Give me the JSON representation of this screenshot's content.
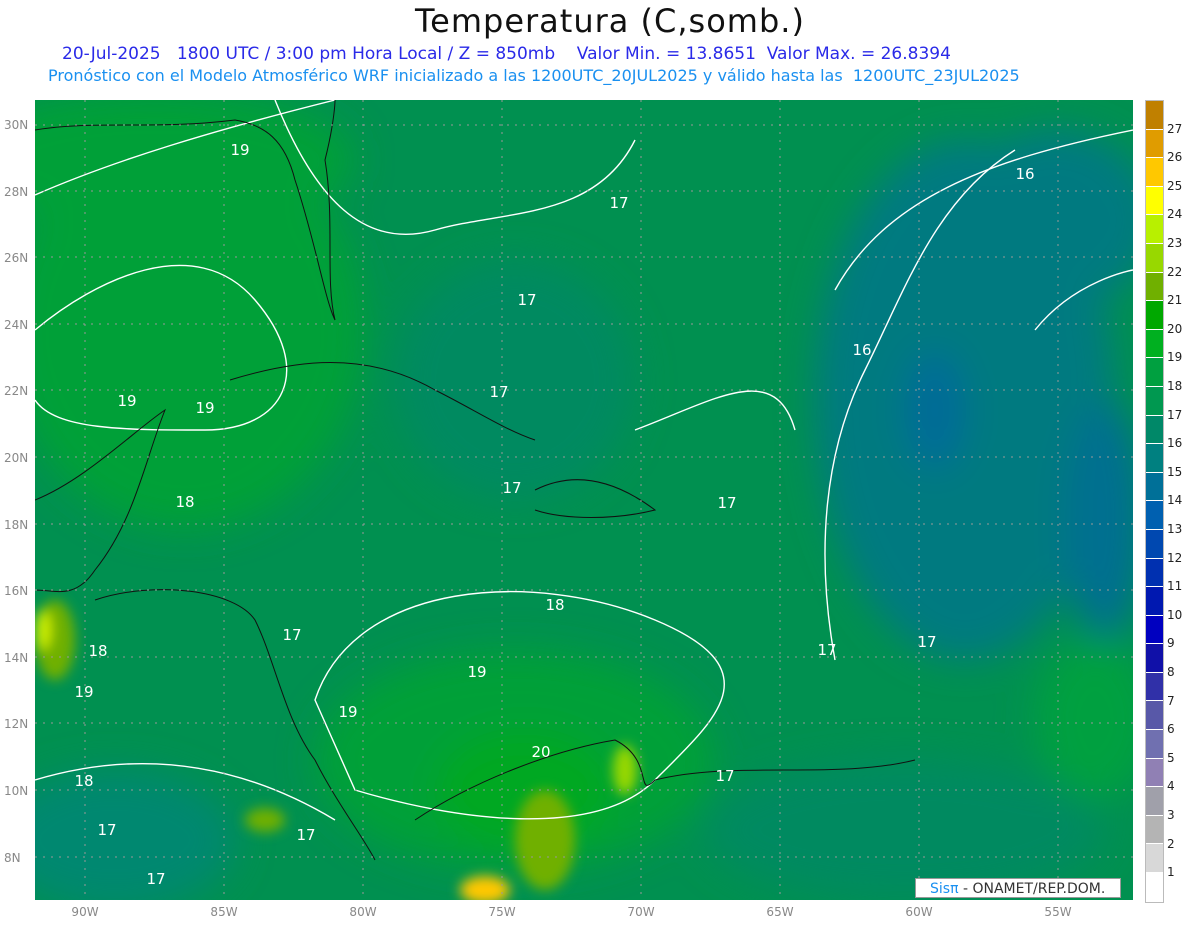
{
  "header": {
    "title": "Temperatura (C,somb.)",
    "line1": "20-Jul-2025   1800 UTC / 3:00 pm Hora Local / Z = 850mb    Valor Min. = 13.8651  Valor Max. = 26.8394",
    "line2": "Pronóstico con el Modelo Atmosférico WRF inicializado a las 1200UTC_20JUL2025 y válido hasta las  1200UTC_23JUL2025"
  },
  "axes": {
    "lon_labels": [
      "90W",
      "85W",
      "80W",
      "75W",
      "70W",
      "65W",
      "60W",
      " 55W"
    ],
    "lat_labels": [
      "30N",
      "28N",
      "26N",
      "24N",
      "22N",
      "20N",
      "18N",
      "16N",
      "14N",
      "12N",
      "10N",
      "8N"
    ]
  },
  "colorbar": {
    "labels": [
      "27",
      "26",
      "25",
      "24",
      "23",
      "22",
      "21",
      "20",
      "19",
      "18",
      "17",
      "16",
      "15",
      "14",
      "13",
      "12",
      "11",
      "10",
      "9",
      "8",
      "7",
      "6",
      "5",
      "4",
      "3",
      "2",
      "1"
    ],
    "colors": [
      "#c08000",
      "#e09c00",
      "#ffc800",
      "#ffff00",
      "#b8f000",
      "#98d800",
      "#70b000",
      "#00a800",
      "#00b020",
      "#00a040",
      "#009850",
      "#008868",
      "#008080",
      "#007098",
      "#0060b0",
      "#0048b0",
      "#0030b0",
      "#0018b0",
      "#0000c0",
      "#1010a8",
      "#3030a8",
      "#5858a8",
      "#7070b0",
      "#9080b4",
      "#a0a0aa",
      "#b4b4b4",
      "#d8d8d8",
      "#ffffff"
    ]
  },
  "contour_labels": [
    "19",
    "17",
    "16",
    "17",
    "16",
    "19",
    "19",
    "17",
    "17",
    "17",
    "18",
    "18",
    "17",
    "18",
    "17",
    "17",
    "19",
    "19",
    "19",
    "20",
    "18",
    "17",
    "17",
    "17",
    "17"
  ],
  "credit": {
    "brand": "Sisπ",
    "org": " - ONAMET/REP.DOM."
  },
  "value_range": {
    "min": 13.8651,
    "max": 26.8394
  }
}
